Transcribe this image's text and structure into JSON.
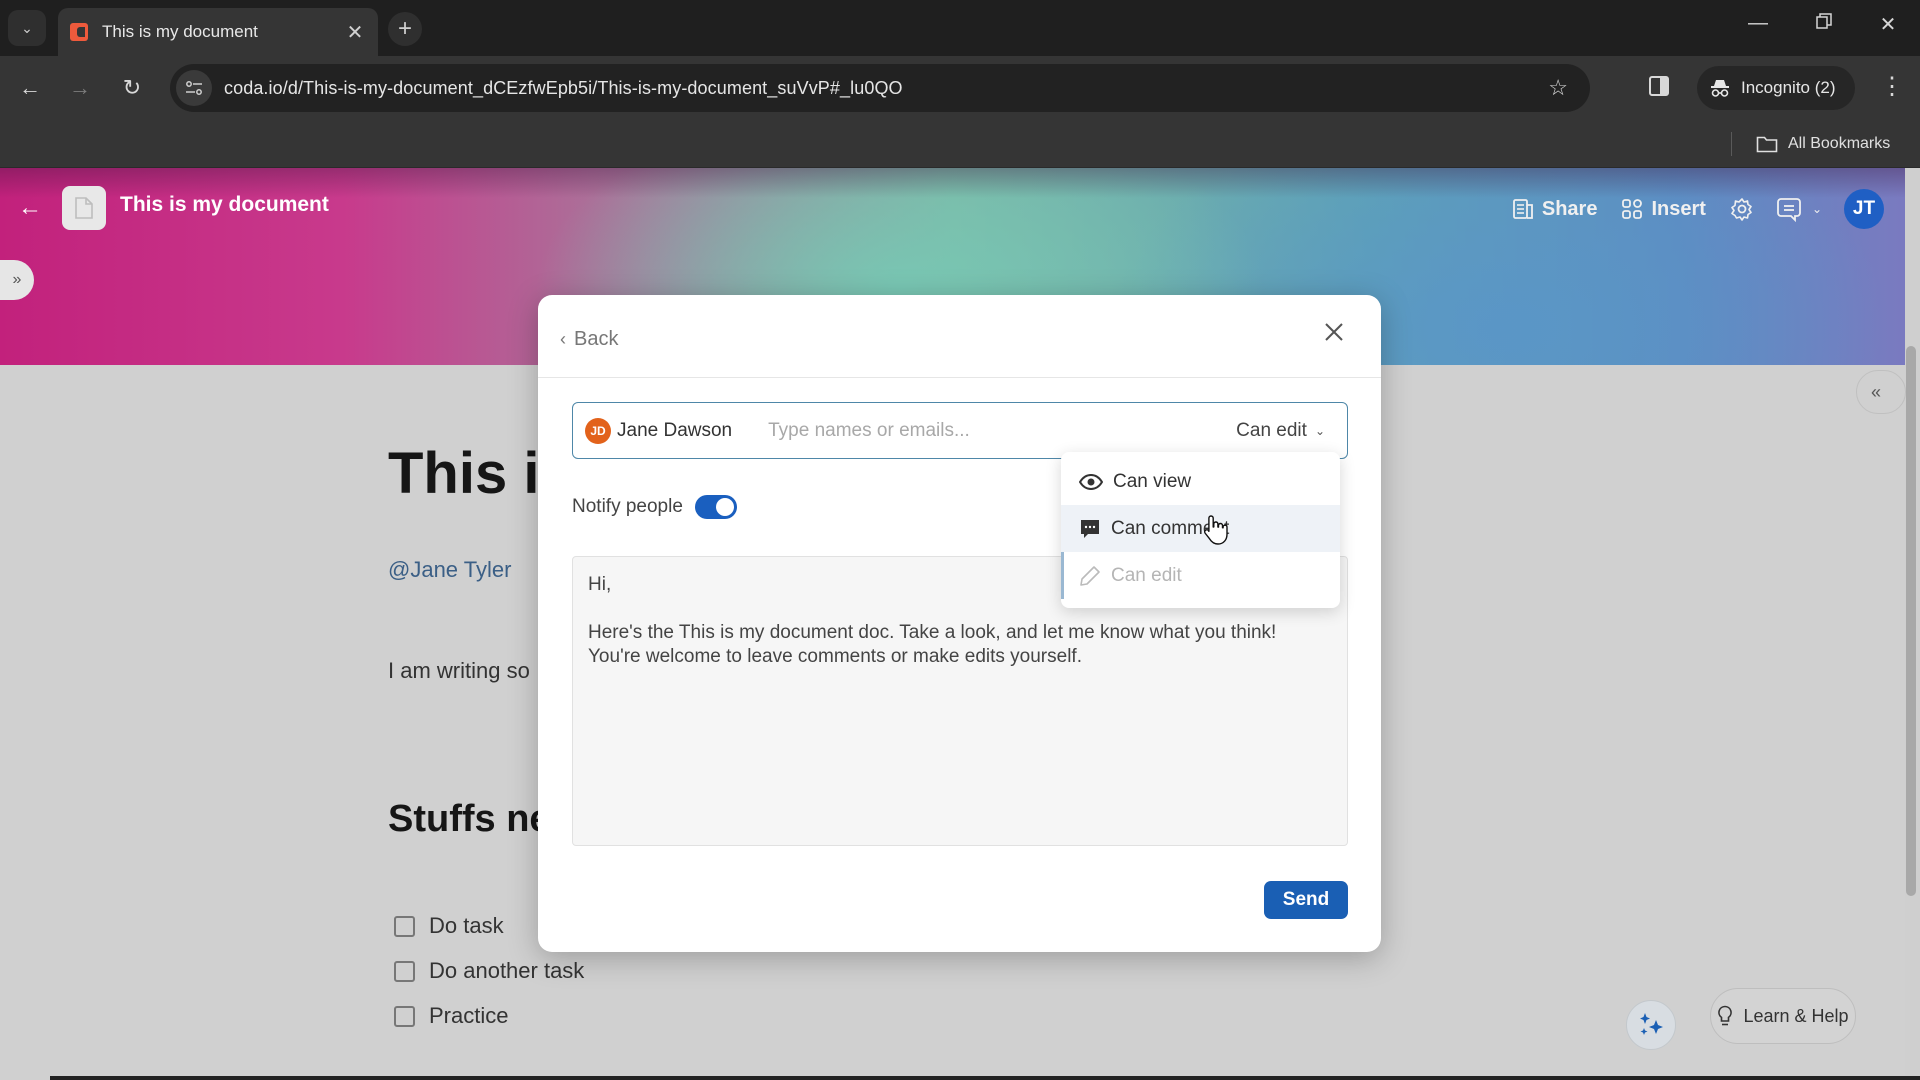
{
  "browser": {
    "tab": {
      "title": "This is my document",
      "favicon": "coda-logo-icon"
    },
    "url": "coda.io/d/This-is-my-document_dCEzfwEpb5i/This-is-my-document_suVvP#_lu0QO",
    "profile_label": "Incognito (2)",
    "bookmarks_label": "All Bookmarks"
  },
  "doc": {
    "title": "This is my document",
    "actions": {
      "share": "Share",
      "insert": "Insert"
    },
    "avatar_initials": "JT",
    "heading": "This is my document",
    "mention": "@Jane Tyler",
    "paragraph": "I am writing so",
    "section_heading": "Stuffs need to be done",
    "todos": [
      {
        "label": "Do task",
        "checked": false
      },
      {
        "label": "Do another task",
        "checked": false
      },
      {
        "label": "Practice",
        "checked": false
      }
    ],
    "help_label": "Learn & Help"
  },
  "share_dialog": {
    "back_label": "Back",
    "recipient": {
      "initials": "JD",
      "name": "Jane Dawson",
      "color": "#e2621b"
    },
    "input_placeholder": "Type names or emails...",
    "permission": "Can edit",
    "notify_label": "Notify people",
    "notify_on": true,
    "message": "Hi,\n\nHere's the This is my document doc. Take a look, and let me know what you think! You're welcome to leave comments or make edits yourself.",
    "send_label": "Send",
    "permission_options": [
      {
        "label": "Can view",
        "icon": "eye-icon",
        "state": "default"
      },
      {
        "label": "Can comment",
        "icon": "comment-icon",
        "state": "hover"
      },
      {
        "label": "Can edit",
        "icon": "pencil-icon",
        "state": "selected"
      }
    ]
  },
  "colors": {
    "accent": "#1a5fb4",
    "toggle_on": "#1a5fbf",
    "avatar_jt": "#1f5fc4"
  }
}
